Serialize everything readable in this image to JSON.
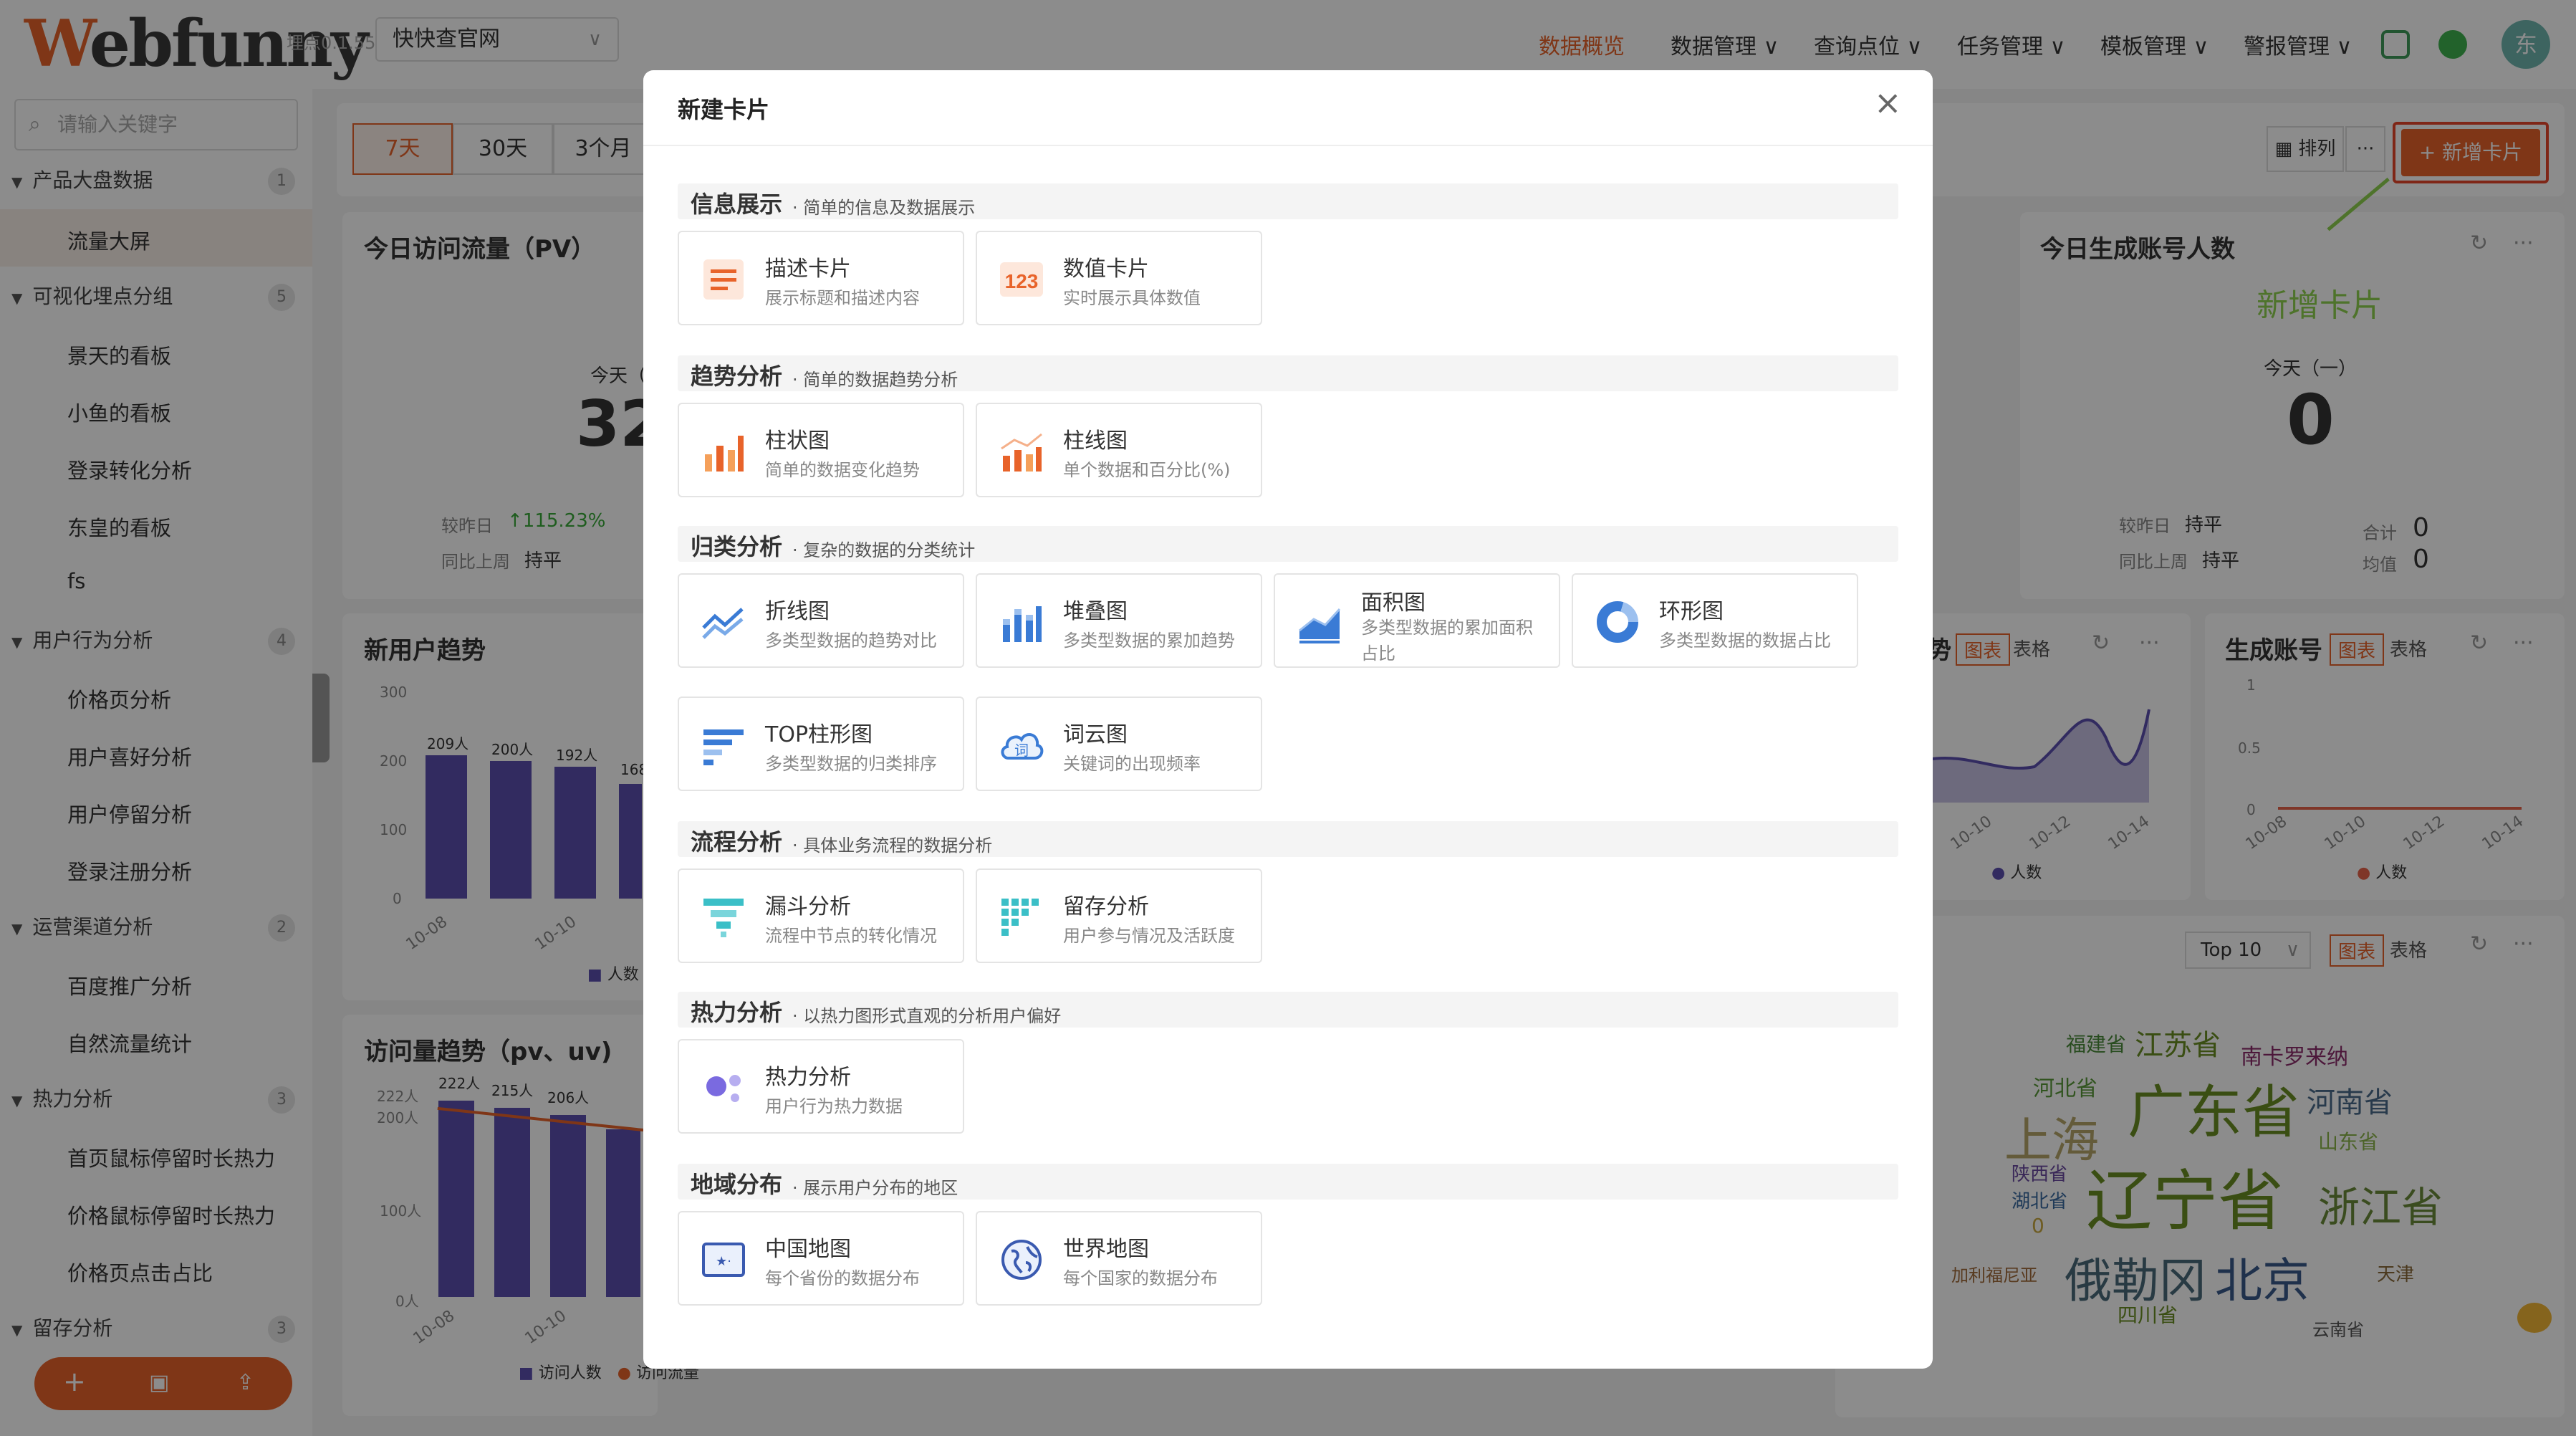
{
  "header": {
    "logo_prefix": "W",
    "logo_rest": "ebfunny",
    "version": "埋点0.1.55",
    "project": "快快查官网",
    "nav": [
      "数据概览",
      "数据管理 ∨",
      "查询点位 ∨",
      "任务管理 ∨",
      "模板管理 ∨",
      "警报管理 ∨"
    ],
    "avatar": "东"
  },
  "sidebar": {
    "search_placeholder": "请输入关键字",
    "groups": [
      {
        "label": "产品大盘数据",
        "count": "1",
        "items": [
          "流量大屏"
        ]
      },
      {
        "label": "可视化埋点分组",
        "count": "5",
        "items": [
          "景天的看板",
          "小鱼的看板",
          "登录转化分析",
          "东皇的看板",
          "fs"
        ]
      },
      {
        "label": "用户行为分析",
        "count": "4",
        "items": [
          "价格页分析",
          "用户喜好分析",
          "用户停留分析",
          "登录注册分析"
        ]
      },
      {
        "label": "运营渠道分析",
        "count": "2",
        "items": [
          "百度推广分析",
          "自然流量统计"
        ]
      },
      {
        "label": "热力分析",
        "count": "3",
        "items": [
          "首页鼠标停留时长热力",
          "价格鼠标停留时长热力",
          "价格页点击占比"
        ]
      },
      {
        "label": "留存分析",
        "count": "3",
        "items": []
      }
    ]
  },
  "toolbar": {
    "ranges": [
      "7天",
      "30天",
      "3个月"
    ],
    "sort_label": "排列",
    "more": "···",
    "add_card": "+ 新增卡片",
    "annotation": "新增卡片"
  },
  "cards": {
    "pv": {
      "title": "今日访问流量（PV）",
      "today": "今天（",
      "value": "32",
      "vs_yesterday": "较昨日",
      "vs_pct": "↑115.23%",
      "vs_week": "同比上周",
      "week_val": "持平"
    },
    "accounts": {
      "title": "今日生成账号人数",
      "today": "今天（一）",
      "value": "0",
      "vs_yesterday": "较昨日",
      "y_val": "持平",
      "vs_week": "同比上周",
      "w_val": "持平",
      "total_label": "合计",
      "total": "0",
      "avg_label": "均值",
      "avg": "0"
    },
    "newusers": {
      "title": "新用户趋势",
      "yticks": [
        "300",
        "200",
        "100",
        "0"
      ],
      "labels": [
        "209人",
        "200人",
        "192人",
        "168"
      ],
      "xticks": [
        "10-08",
        "10-10"
      ],
      "legend": "人数"
    },
    "visits": {
      "title": "访问量趋势（pv、uv)",
      "yticks": [
        "222人",
        "200人",
        "100人",
        "0人"
      ],
      "labels": [
        "222人",
        "215人",
        "206人"
      ],
      "xticks": [
        "10-08",
        "10-10"
      ],
      "legend1": "访问人数",
      "legend2": "访问流量"
    },
    "trend_right": {
      "title": "势",
      "tab_chart": "图表",
      "tab_table": "表格",
      "xticks": [
        "10-10",
        "10-12",
        "10-14"
      ],
      "legend": "人数"
    },
    "accounts_trend": {
      "title": "生成账号",
      "tab_chart": "图表",
      "tab_table": "表格",
      "yticks": [
        "1",
        "0.5",
        "0"
      ],
      "xticks": [
        "10-08",
        "10-10",
        "10-12",
        "10-14"
      ],
      "legend": "人数"
    },
    "wordcloud": {
      "top": "Top 10",
      "tab_chart": "图表",
      "tab_table": "表格",
      "words": [
        "福建省",
        "江苏省",
        "南卡罗来纳",
        "河北省",
        "广东省",
        "河南省",
        "上海",
        "山东省",
        "陕西省",
        "湖北省",
        "0",
        "辽宁省",
        "浙江省",
        "加利福尼亚",
        "俄勒冈",
        "北京",
        "天津",
        "四川省",
        "云南省"
      ]
    }
  },
  "modal": {
    "title": "新建卡片",
    "close": "×",
    "sections": [
      {
        "title": "信息展示",
        "desc": "· 简单的信息及数据展示",
        "options": [
          {
            "name": "描述卡片",
            "desc": "展示标题和描述内容",
            "icon": "text-card-icon"
          },
          {
            "name": "数值卡片",
            "desc": "实时展示具体数值",
            "icon": "number-card-icon"
          }
        ]
      },
      {
        "title": "趋势分析",
        "desc": "· 简单的数据趋势分析",
        "options": [
          {
            "name": "柱状图",
            "desc": "简单的数据变化趋势",
            "icon": "bar-chart-icon"
          },
          {
            "name": "柱线图",
            "desc": "单个数据和百分比(%)",
            "icon": "bar-line-chart-icon"
          }
        ]
      },
      {
        "title": "归类分析",
        "desc": "· 复杂的数据的分类统计",
        "options": [
          {
            "name": "折线图",
            "desc": "多类型数据的趋势对比",
            "icon": "line-chart-icon"
          },
          {
            "name": "堆叠图",
            "desc": "多类型数据的累加趋势",
            "icon": "stacked-chart-icon"
          },
          {
            "name": "面积图",
            "desc": "多类型数据的累加面积占比",
            "icon": "area-chart-icon"
          },
          {
            "name": "环形图",
            "desc": "多类型数据的数据占比",
            "icon": "donut-chart-icon"
          },
          {
            "name": "TOP柱形图",
            "desc": "多类型数据的归类排序",
            "icon": "top-bar-chart-icon"
          },
          {
            "name": "词云图",
            "desc": "关键词的出现频率",
            "icon": "word-cloud-icon"
          }
        ]
      },
      {
        "title": "流程分析",
        "desc": "· 具体业务流程的数据分析",
        "options": [
          {
            "name": "漏斗分析",
            "desc": "流程中节点的转化情况",
            "icon": "funnel-icon"
          },
          {
            "name": "留存分析",
            "desc": "用户参与情况及活跃度",
            "icon": "retention-icon"
          }
        ]
      },
      {
        "title": "热力分析",
        "desc": "· 以热力图形式直观的分析用户偏好",
        "options": [
          {
            "name": "热力分析",
            "desc": "用户行为热力数据",
            "icon": "heatmap-icon"
          }
        ]
      },
      {
        "title": "地域分布",
        "desc": "· 展示用户分布的地区",
        "options": [
          {
            "name": "中国地图",
            "desc": "每个省份的数据分布",
            "icon": "china-map-icon"
          },
          {
            "name": "世界地图",
            "desc": "每个国家的数据分布",
            "icon": "world-map-icon"
          }
        ]
      }
    ]
  },
  "colors": {
    "accent": "#e8632a",
    "bar": "#5b4fb0",
    "annotation": "#8fd14f"
  }
}
